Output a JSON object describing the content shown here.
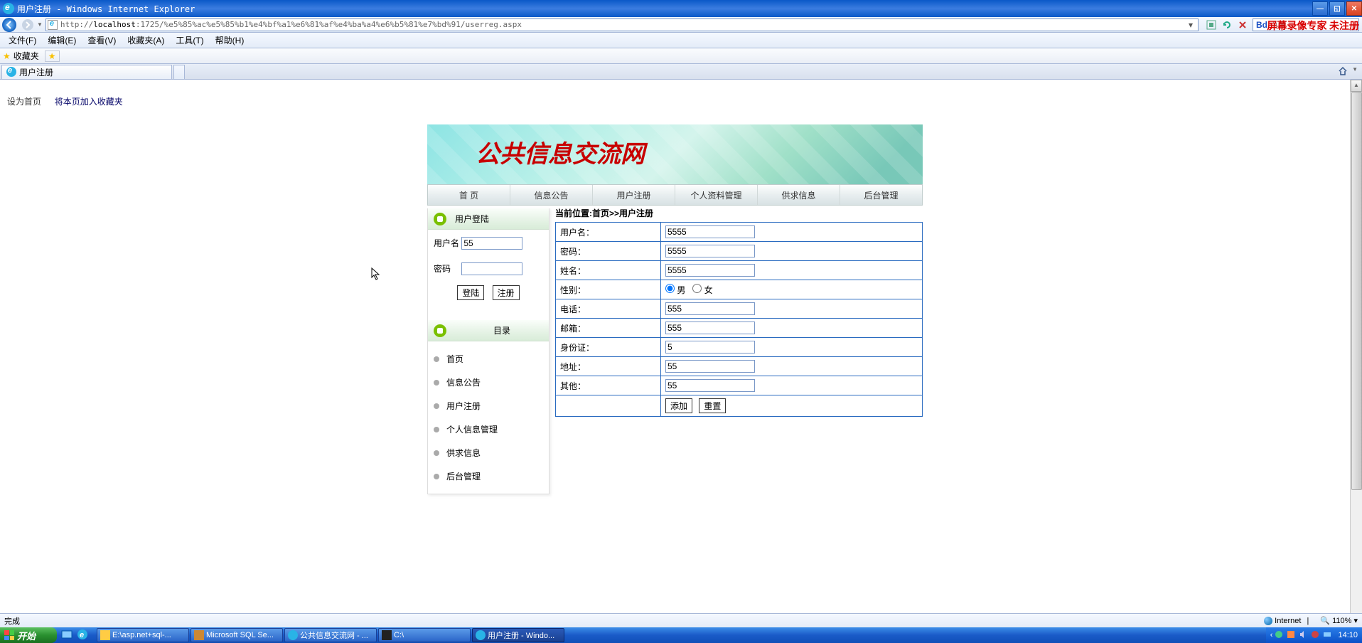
{
  "window": {
    "title": "用户注册 - Windows Internet Explorer"
  },
  "address": {
    "prefix": "http://",
    "host": "localhost",
    "path": ":1725/%e5%85%ac%e5%85%b1%e4%bf%a1%e6%81%af%e4%ba%a4%e6%b5%81%e7%bd%91/userreg.aspx"
  },
  "search": {
    "engine": "百度"
  },
  "watermark": "屏幕录像专家 未注册",
  "menu": [
    "文件(F)",
    "编辑(E)",
    "查看(V)",
    "收藏夹(A)",
    "工具(T)",
    "帮助(H)"
  ],
  "favbar": {
    "label": "收藏夹"
  },
  "tab": {
    "title": "用户注册"
  },
  "toplinks": {
    "home": "设为首页",
    "fav": "将本页加入收藏夹"
  },
  "banner": {
    "title": "公共信息交流网"
  },
  "nav": [
    "首  页",
    "信息公告",
    "用户注册",
    "个人资料管理",
    "供求信息",
    "后台管理"
  ],
  "login": {
    "heading": "用户登陆",
    "user_label": "用户名",
    "user_value": "55",
    "pass_label": "密码",
    "pass_value": "",
    "login_btn": "登陆",
    "reg_btn": "注册"
  },
  "catalog": {
    "heading": "目录",
    "items": [
      "首页",
      "信息公告",
      "用户注册",
      "个人信息管理",
      "供求信息",
      "后台管理"
    ]
  },
  "breadcrumb": "当前位置:首页>>用户注册",
  "form": {
    "rows": [
      {
        "label": "用户名：",
        "value": "5555",
        "type": "text"
      },
      {
        "label": "密码：",
        "value": "5555",
        "type": "text"
      },
      {
        "label": "姓名：",
        "value": "5555",
        "type": "text"
      },
      {
        "label": "性别：",
        "type": "radio",
        "male": "男",
        "female": "女"
      },
      {
        "label": "电话：",
        "value": "555",
        "type": "text"
      },
      {
        "label": "邮箱：",
        "value": "555",
        "type": "text"
      },
      {
        "label": "身份证：",
        "value": "5",
        "type": "text"
      },
      {
        "label": "地址：",
        "value": "55",
        "type": "text"
      },
      {
        "label": "其他：",
        "value": "55",
        "type": "text"
      }
    ],
    "add_btn": "添加",
    "reset_btn": "重置"
  },
  "status": {
    "done": "完成",
    "zone": "Internet",
    "protected": "",
    "zoom": "110%"
  },
  "taskbar": {
    "start": "开始",
    "tasks": [
      "E:\\asp.net+sql-...",
      "Microsoft SQL Se...",
      "公共信息交流网 - ...",
      "C:\\",
      "用户注册 - Windo..."
    ],
    "clock": "14:10"
  }
}
